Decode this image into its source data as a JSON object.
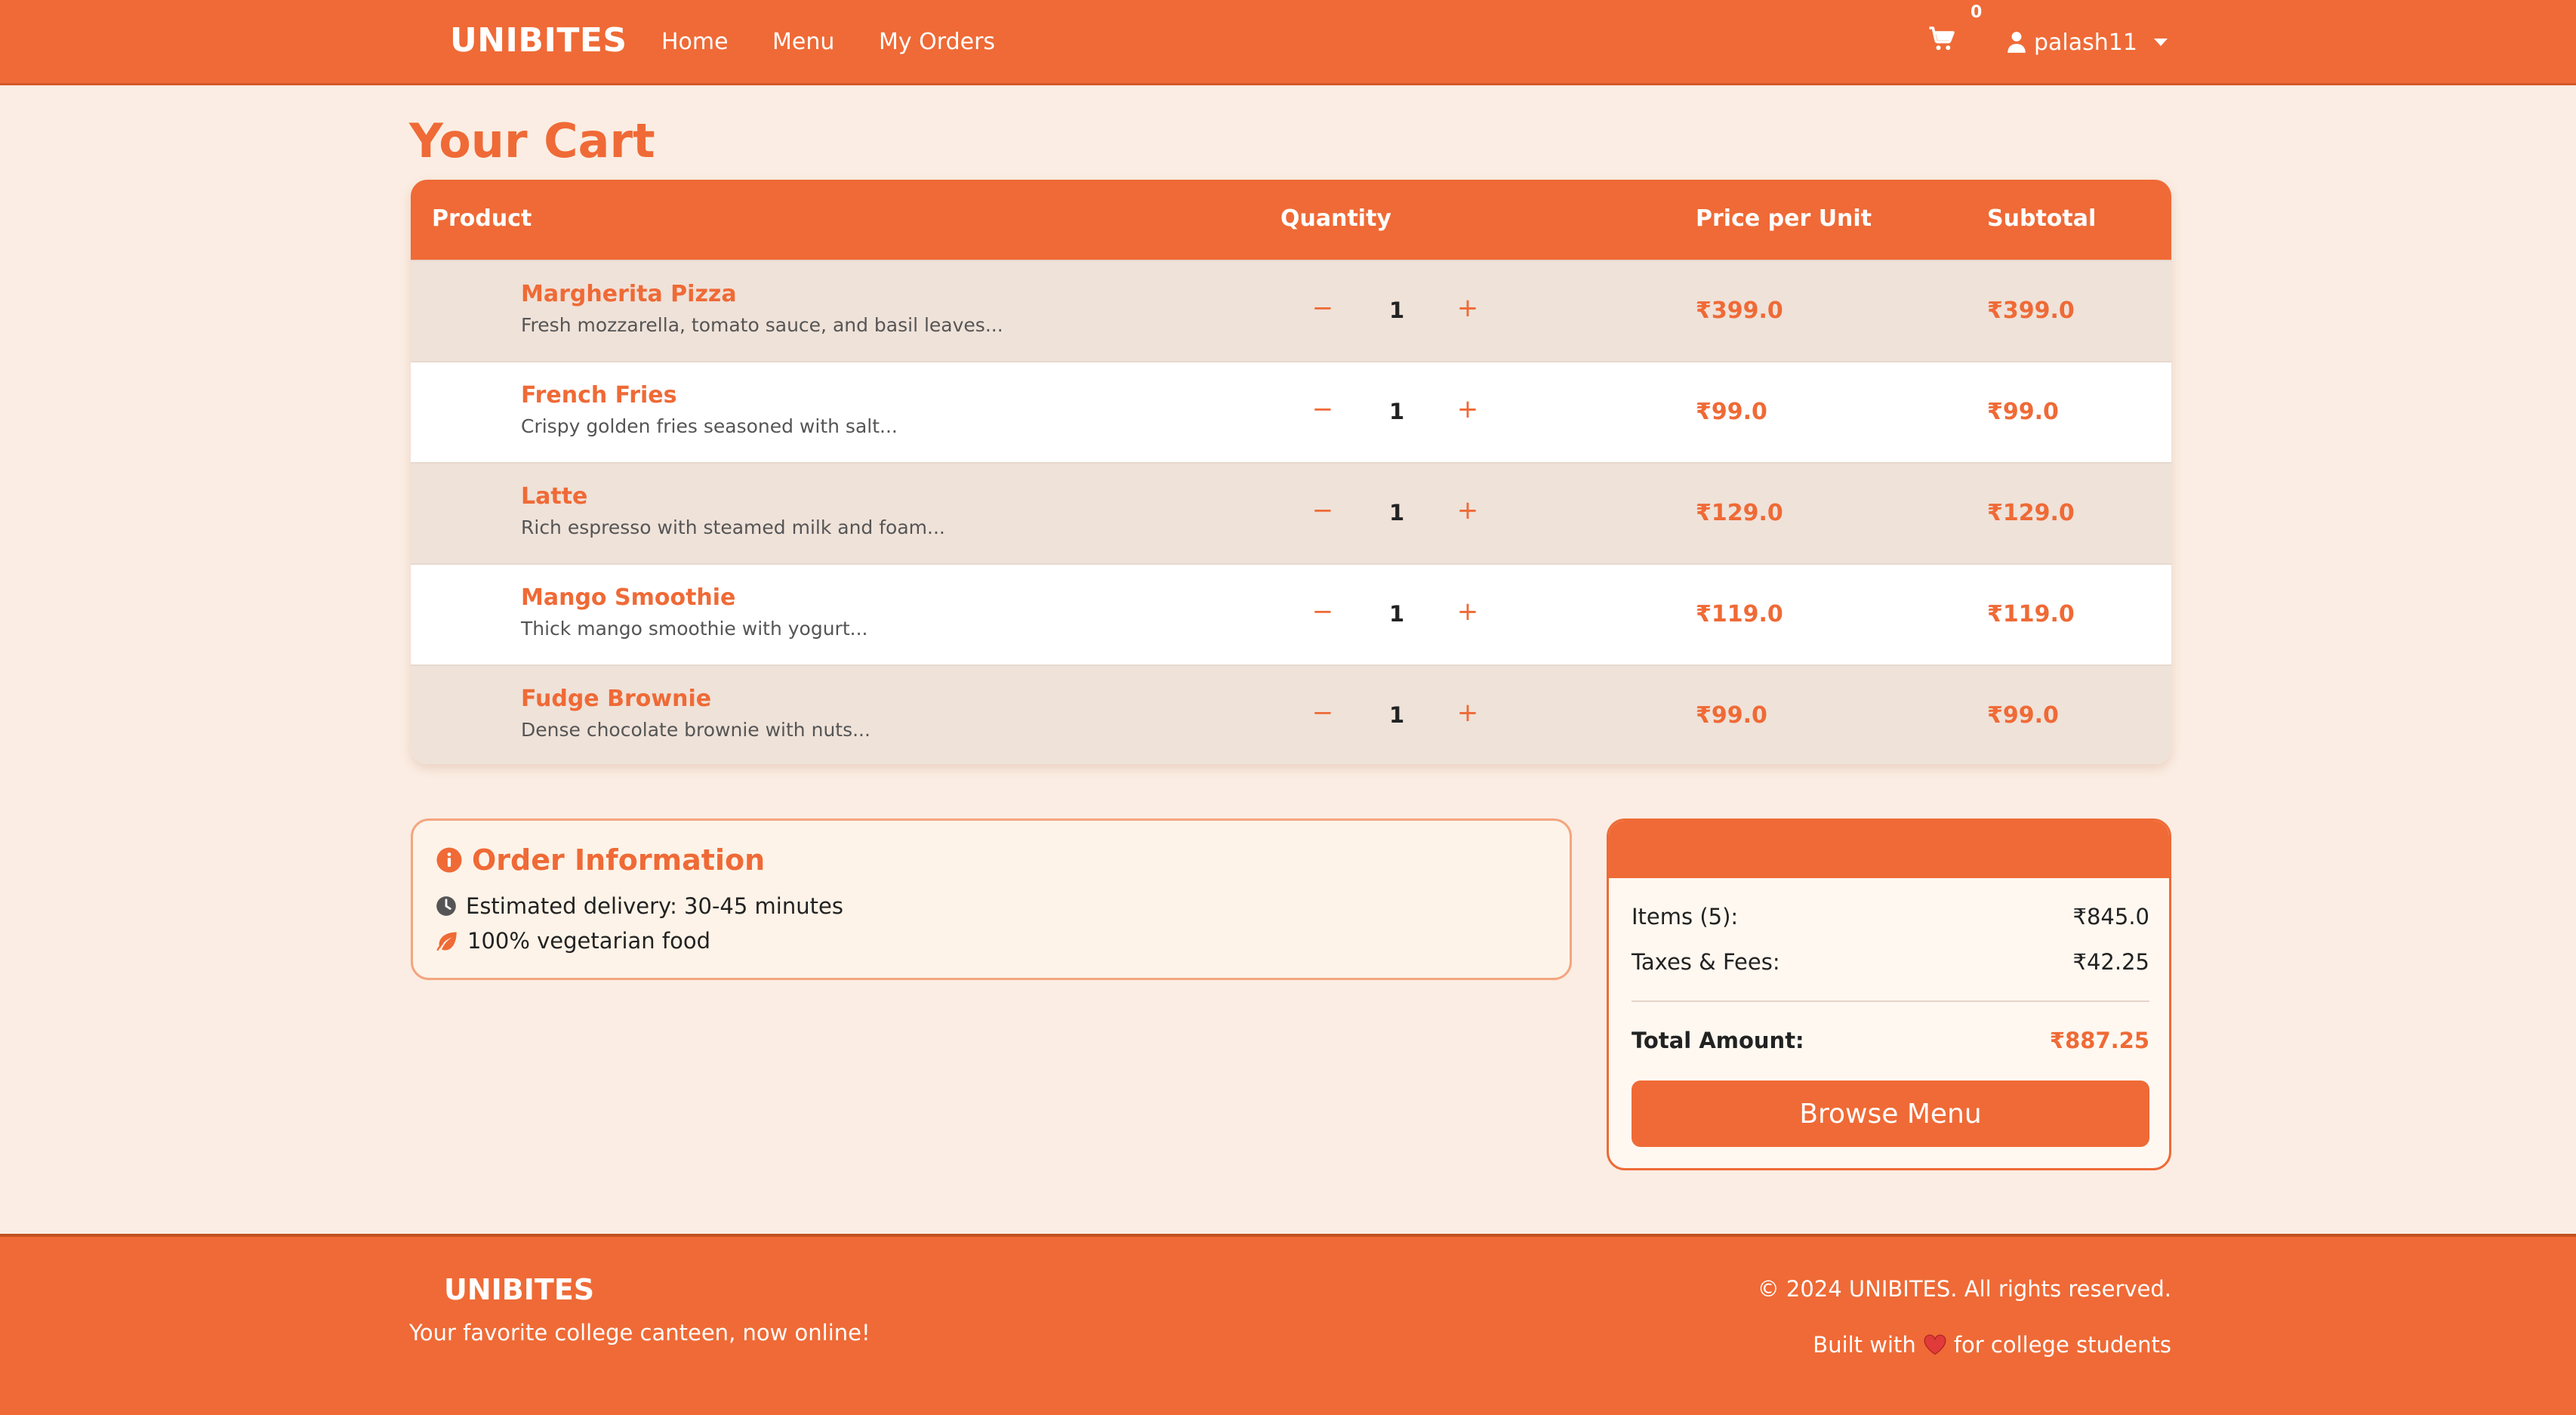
{
  "nav": {
    "brand": "UNIBITES",
    "links": [
      "Home",
      "Menu",
      "My Orders"
    ],
    "cart_count": "0",
    "username": "palash11"
  },
  "page_title": "Your Cart",
  "cart": {
    "headers": {
      "product": "Product",
      "quantity": "Quantity",
      "price": "Price per Unit",
      "subtotal": "Subtotal"
    },
    "items": [
      {
        "name": "Margherita Pizza",
        "desc": "Fresh mozzarella, tomato sauce, and basil leaves...",
        "qty": "1",
        "price": "₹399.0",
        "subtotal": "₹399.0"
      },
      {
        "name": "French Fries",
        "desc": "Crispy golden fries seasoned with salt...",
        "qty": "1",
        "price": "₹99.0",
        "subtotal": "₹99.0"
      },
      {
        "name": "Latte",
        "desc": "Rich espresso with steamed milk and foam...",
        "qty": "1",
        "price": "₹129.0",
        "subtotal": "₹129.0"
      },
      {
        "name": "Mango Smoothie",
        "desc": "Thick mango smoothie with yogurt...",
        "qty": "1",
        "price": "₹119.0",
        "subtotal": "₹119.0"
      },
      {
        "name": "Fudge Brownie",
        "desc": "Dense chocolate brownie with nuts...",
        "qty": "1",
        "price": "₹99.0",
        "subtotal": "₹99.0"
      }
    ],
    "minus_symbol": "−",
    "plus_symbol": "+"
  },
  "order_info": {
    "title": "Order Information",
    "delivery": "Estimated delivery: 30-45 minutes",
    "veg": "100% vegetarian food"
  },
  "summary": {
    "items_label": "Items (5):",
    "items_value": "₹845.0",
    "taxes_label": "Taxes & Fees:",
    "taxes_value": "₹42.25",
    "total_label": "Total Amount:",
    "total_value": "₹887.25",
    "browse_button": "Browse Menu"
  },
  "footer": {
    "brand": "UNIBITES",
    "tagline": "Your favorite college canteen, now online!",
    "copyright": "© 2024 UNIBITES. All rights reserved.",
    "built_prefix": "Built with",
    "built_suffix": "for college students"
  },
  "colors": {
    "accent": "#ef6a36",
    "page_background": "#fbede3",
    "row_alt": "#efe2d9",
    "heart": "#e03a3a"
  },
  "icons": {
    "cart": "cart-icon",
    "user": "user-icon",
    "caret": "caret-down-icon",
    "info": "info-circle-icon",
    "clock": "clock-icon",
    "leaf": "leaf-icon",
    "heart": "heart-icon"
  }
}
